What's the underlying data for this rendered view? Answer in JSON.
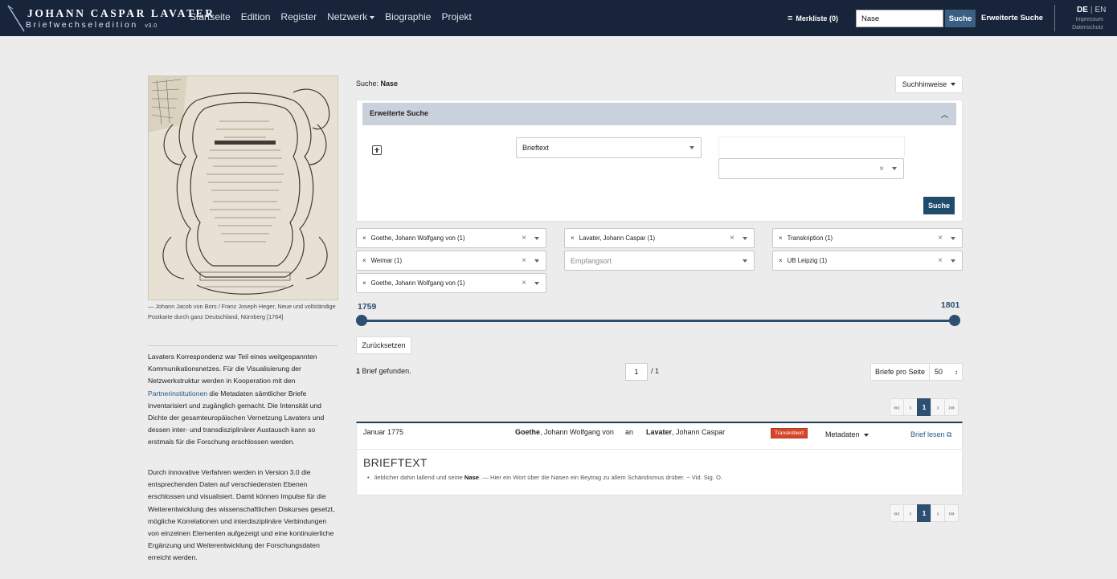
{
  "navbar": {
    "brand_title": "JOHANN CASPAR LAVATER",
    "brand_subtitle": "Briefwechseledition",
    "brand_version": "v3.0",
    "links": [
      "Startseite",
      "Edition",
      "Register",
      "Netzwerk",
      "Biographie",
      "Projekt"
    ],
    "merkliste": "Merkliste (0)",
    "search_value": "Nase",
    "search_button": "Suche",
    "extended_search": "Erweiterte Suche",
    "lang_de": "DE",
    "lang_sep": "|",
    "lang_en": "EN",
    "impressum": "Impressum",
    "datenschutz": "Datenschutz"
  },
  "sidebar": {
    "image_caption": "Johann Jacob von Bors / Franz Joseph Heger, Neue und vollständige Postkarte durch ganz Deutschland, Nürnberg [1764]",
    "caption_dash": "—",
    "paragraph1_a": "Lavaters Korrespondenz war Teil eines weitgespannten Kommunikationsnetzes. Für die Visualisierung der Netzwerkstruktur werden in Kooperation mit den ",
    "paragraph1_link": "Partnerinstitutionen",
    "paragraph1_b": " die Metadaten sämtlicher Briefe inventarisiert und zugänglich gemacht. Die Intensität und Dichte der gesamteuropäischen Vernetzung Lavaters und dessen inter- und transdisziplinärer Austausch kann so erstmals für die Forschung erschlossen werden.",
    "paragraph2": "Durch innovative Verfahren werden in Version 3.0 die entsprechenden Daten auf verschiedensten Ebenen erschlossen und visualisiert. Damit können Impulse für die Weiterentwicklung des wissenschaftlichen Diskurses gesetzt, mögliche Korrelationen und interdisziplinäre Verbindungen von einzelnen Elementen aufgezeigt und eine kontinuierliche Ergänzung und Weiterentwicklung der Forschungsdaten erreicht werden."
  },
  "search": {
    "label": "Suche:",
    "term": "Nase",
    "hints_button": "Suchhinweise",
    "advanced_header": "Erweiterte Suche",
    "field_select": "Brieftext",
    "submit": "Suche"
  },
  "filters": {
    "col1": [
      "Goethe, Johann Wolfgang von (1)",
      "Weimar (1)",
      "Goethe, Johann Wolfgang von (1)"
    ],
    "col2_recipient": "Lavater, Johann Caspar (1)",
    "col2_placeholder": "Empfangsort",
    "col3": [
      "Transkription (1)",
      "UB Leipzig (1)"
    ]
  },
  "timeline": {
    "start_year": "1759",
    "end_year": "1801"
  },
  "results": {
    "reset_button": "Zurücksetzen",
    "count": "1",
    "count_label": "Brief gefunden.",
    "page_current": "1",
    "page_total": "/ 1",
    "per_page_label": "Briefe pro Seite",
    "per_page_value": "50",
    "pager": [
      "«‹",
      "‹",
      "1",
      "›",
      "›»"
    ],
    "letter": {
      "date": "Januar 1775",
      "from_last": "Goethe",
      "from_first": ", Johann Wolfgang von",
      "an": "an",
      "to_last": "Lavater",
      "to_first": ", Johann Caspar",
      "badge": "Transkribiert",
      "metadata": "Metadaten",
      "read": "Brief lesen",
      "section": "BRIEFTEXT",
      "snippet_pre": "lieblicher dahin lallend und seine ",
      "snippet_hit": "Nase",
      "snippet_post": ". — Hier ein Wort über die Nasen ein Beytrag zu allem Schändismus drüber. ~ Vid. Sig. O."
    }
  },
  "colors": {
    "navbar": "#17243a",
    "primary": "#1f4c6b",
    "accent": "#2d4f72",
    "badge": "#d6462a"
  }
}
